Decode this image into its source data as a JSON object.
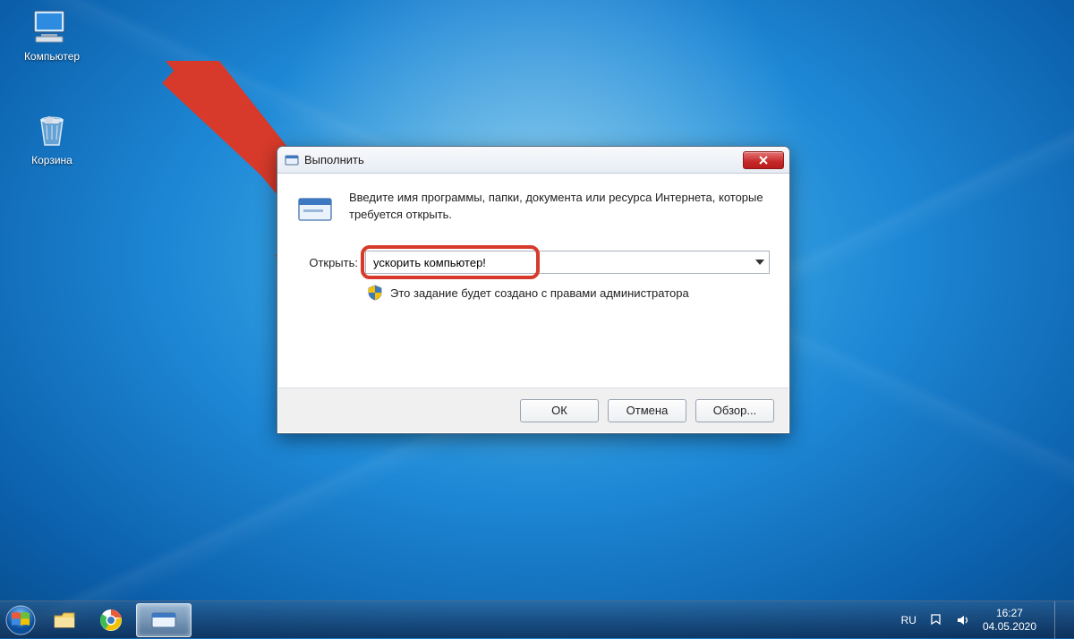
{
  "desktop": {
    "icons": {
      "computer": "Компьютер",
      "recycle_bin": "Корзина"
    }
  },
  "run_dialog": {
    "title": "Выполнить",
    "description": "Введите имя программы, папки, документа или ресурса Интернета, которые требуется открыть.",
    "open_label": "Открыть:",
    "input_value": "ускорить компьютер!",
    "admin_note": "Это задание будет создано с правами администратора",
    "buttons": {
      "ok": "ОК",
      "cancel": "Отмена",
      "browse": "Обзор..."
    }
  },
  "taskbar": {
    "language": "RU",
    "clock": {
      "time": "16:27",
      "date": "04.05.2020"
    }
  },
  "annotation": {
    "arrow_color": "#d73a2a"
  }
}
